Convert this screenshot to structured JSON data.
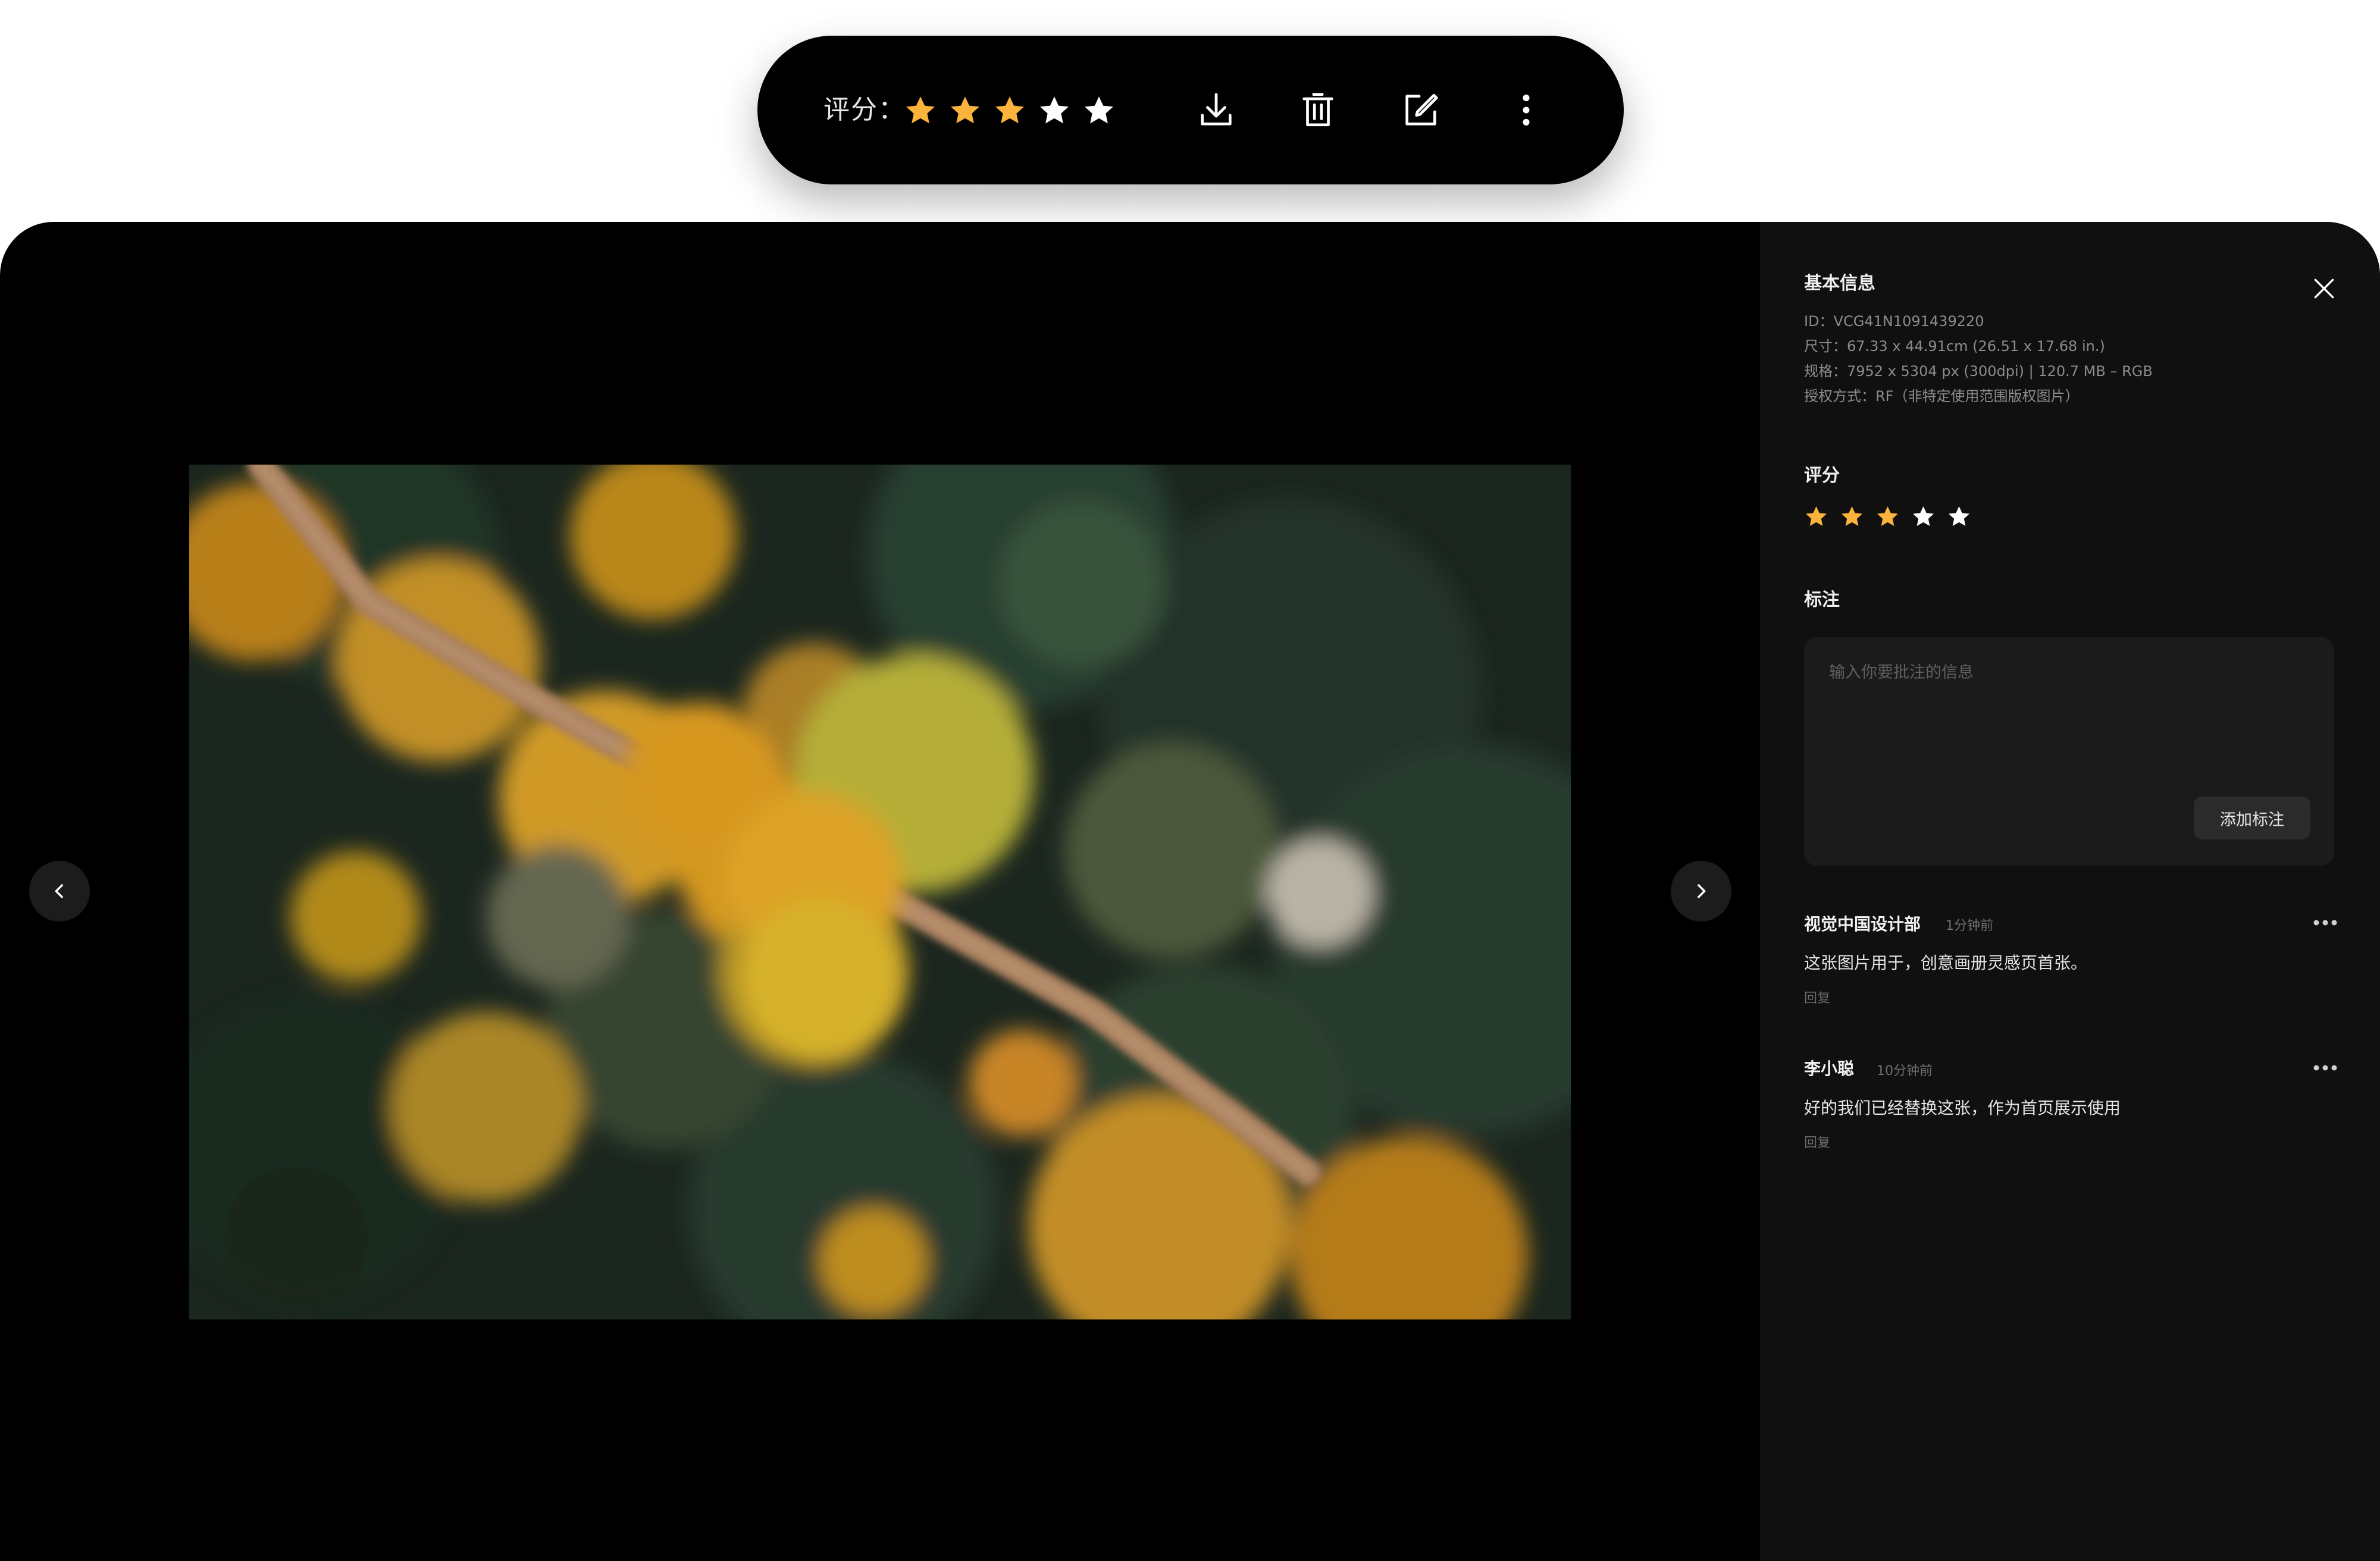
{
  "toolbar": {
    "rating_label": "评分：",
    "rating_value": 3,
    "rating_max": 5,
    "icons": [
      "download-icon",
      "trash-icon",
      "edit-icon",
      "more-vertical-icon"
    ]
  },
  "viewer": {
    "prev_icon": "chevron-left-icon",
    "next_icon": "chevron-right-icon",
    "image_subject": "aerial view of a dirt road through an autumn forest"
  },
  "panel": {
    "basic_info_title": "基本信息",
    "id_line": "ID：VCG41N1091439220",
    "size_line": "尺寸：67.33 x 44.91cm (26.51 x 17.68 in.)",
    "spec_line": "规格：7952 x 5304 px (300dpi) | 120.7 MB – RGB",
    "license_line": "授权方式：RF（非特定使用范围版权图片）",
    "rating_title": "评分",
    "rating_value": 3,
    "rating_max": 5,
    "annotation_title": "标注",
    "annotation_placeholder": "输入你要批注的信息",
    "add_annotation_button": "添加标注"
  },
  "comments": [
    {
      "author": "视觉中国设计部",
      "time": "1分钟前",
      "text": "这张图片用于，创意画册灵感页首张。",
      "reply": "回复"
    },
    {
      "author": "李小聪",
      "time": "10分钟前",
      "text": "好的我们已经替换这张，作为首页展示使用",
      "reply": "回复"
    }
  ],
  "colors": {
    "star_active": "#FBB33B",
    "star_inactive": "#FFFFFF",
    "panel_bg": "#101010",
    "viewer_bg": "#000000"
  }
}
